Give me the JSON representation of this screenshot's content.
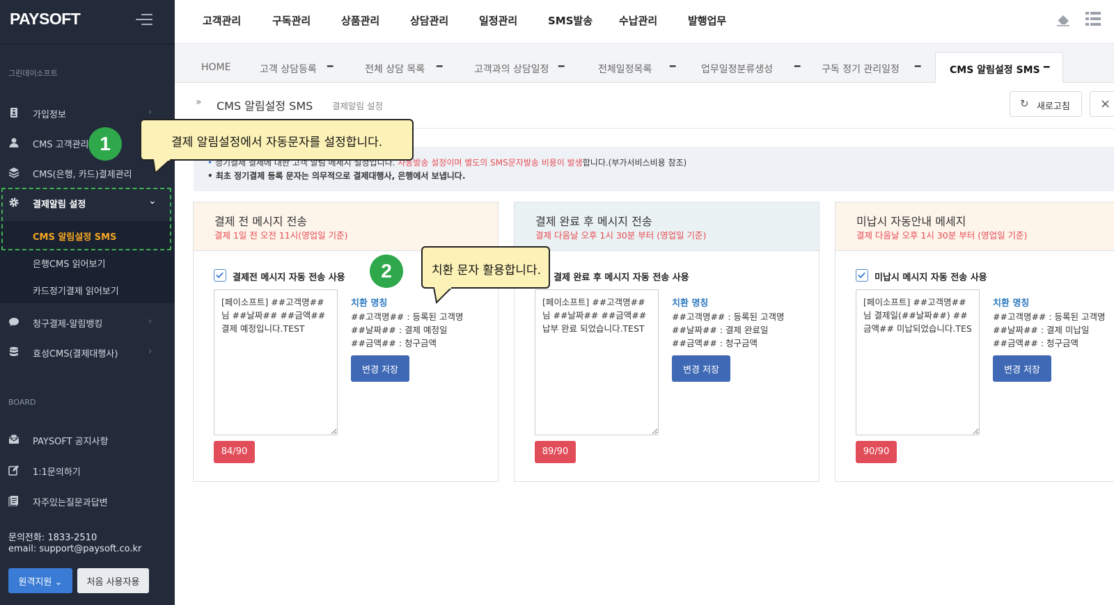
{
  "app": {
    "logo": "PAYSOFT"
  },
  "sidebar": {
    "company": "그린데이소프트",
    "items": [
      {
        "label": "가입정보",
        "icon": "id-card-icon"
      },
      {
        "label": "CMS 고객관리",
        "icon": "user-icon"
      },
      {
        "label": "CMS(은행, 카드)결제관리",
        "icon": "layers-icon"
      },
      {
        "label": "결제알림 설정",
        "icon": "gear-icon"
      },
      {
        "label": "청구결제-알림뱅킹",
        "icon": "chat-icon"
      },
      {
        "label": "효성CMS(결제대행사)",
        "icon": "database-icon"
      }
    ],
    "submenu": [
      "CMS 알림설정 SMS",
      "은행CMS 읽어보기",
      "카드정기결제 읽어보기"
    ],
    "board_title": "BOARD",
    "board": [
      {
        "label": "PAYSOFT 공지사항",
        "icon": "envelope-icon"
      },
      {
        "label": "1:1문의하기",
        "icon": "edit-icon"
      },
      {
        "label": "자주있는질문과답변",
        "icon": "document-icon"
      }
    ],
    "phone": "문의전화: 1833-2510",
    "email": "email: support@paysoft.co.kr",
    "btn_remote": "원격지원",
    "btn_first": "처음 사용자용"
  },
  "topmenu": [
    "고객관리",
    "구독관리",
    "상품관리",
    "상담관리",
    "일정관리",
    "SMS발송",
    "수납관리",
    "발행업무"
  ],
  "tabs": [
    "HOME",
    "고객 상담등록",
    "전체 상담 목록",
    "고객과의 상담일정",
    "전체일정목록",
    "업무일정분류생성",
    "구독 정기 관리일정",
    "CMS 알림설정 SMS"
  ],
  "tab_close": "━",
  "page": {
    "title": "CMS 알림설정 SMS",
    "subtitle": "결제알림 설정",
    "refresh": "새로고침"
  },
  "notice": {
    "line1_a": "정기결제 결제에 대한 고객 알림 메세지 설정입니다. ",
    "line1_red": "자동발송 설정이며 별도의 SMS문자발송 비용이 발생",
    "line1_b": "합니다.(부가서비스비용 참조)",
    "line2": "• 최초 정기결제 등록 문자는 의무적으로 결제대행사, 은행에서 보냅니다."
  },
  "cards": [
    {
      "title": "결제 전 메시지 전송",
      "subtitle": "결제 1일 전 오전 11시(영업일 기준)",
      "checkbox": "결제전 메시지 자동 전송 사용",
      "text": "[페이소프트] ##고객명##님 ##날짜## ##금액## 결제 예정입니다.TEST",
      "sub_title": "치환 명칭",
      "sub1": "##고객명## : 등록된 고객명",
      "sub2": "##날짜## : 결제 예정일",
      "sub3": "##금액## : 청구금액",
      "save": "변경 저장",
      "count": "84/90"
    },
    {
      "title": "결제 완료 후 메시지 전송",
      "subtitle": "결제 다음날 오후 1시 30분 부터 (영업일 기준)",
      "checkbox": "결제 완료 후 메시지 자동 전송 사용",
      "text": "[페이소프트] ##고객명##님 ##날짜## ##금액## 납부 완료 되었습니다.TEST",
      "sub_title": "치환 명칭",
      "sub1": "##고객명## : 등록된 고객명",
      "sub2": "##날짜## : 결제 완료일",
      "sub3": "##금액## : 청구금액",
      "save": "변경 저장",
      "count": "89/90"
    },
    {
      "title": "미납시 자동안내 메세지",
      "subtitle": "결제 다음날 오후 1시 30분 부터 (영업일 기준)",
      "checkbox": "미납시 메시지 자동 전송 사용",
      "text": "[페이소프트] ##고객명##님 결제일(##날짜##) ##금액## 미납되었습니다.TES",
      "sub_title": "치환 명칭",
      "sub1": "##고객명## : 등록된 고객명",
      "sub2": "##날짜## : 결제 미납일",
      "sub3": "##금액## : 청구금액",
      "save": "변경 저장",
      "count": "90/90"
    }
  ],
  "callouts": {
    "c1": "결제 알림설정에서 자동문자를 설정합니다.",
    "c2": "치환 문자 활용합니다.",
    "b1": "1",
    "b2": "2"
  },
  "colors": {
    "sidebar": "#232b3b",
    "active": "#f5a623",
    "accent": "#3f69b5",
    "danger": "#e24d5a",
    "badge": "#2ea84a",
    "callout": "#fcf2b7"
  }
}
